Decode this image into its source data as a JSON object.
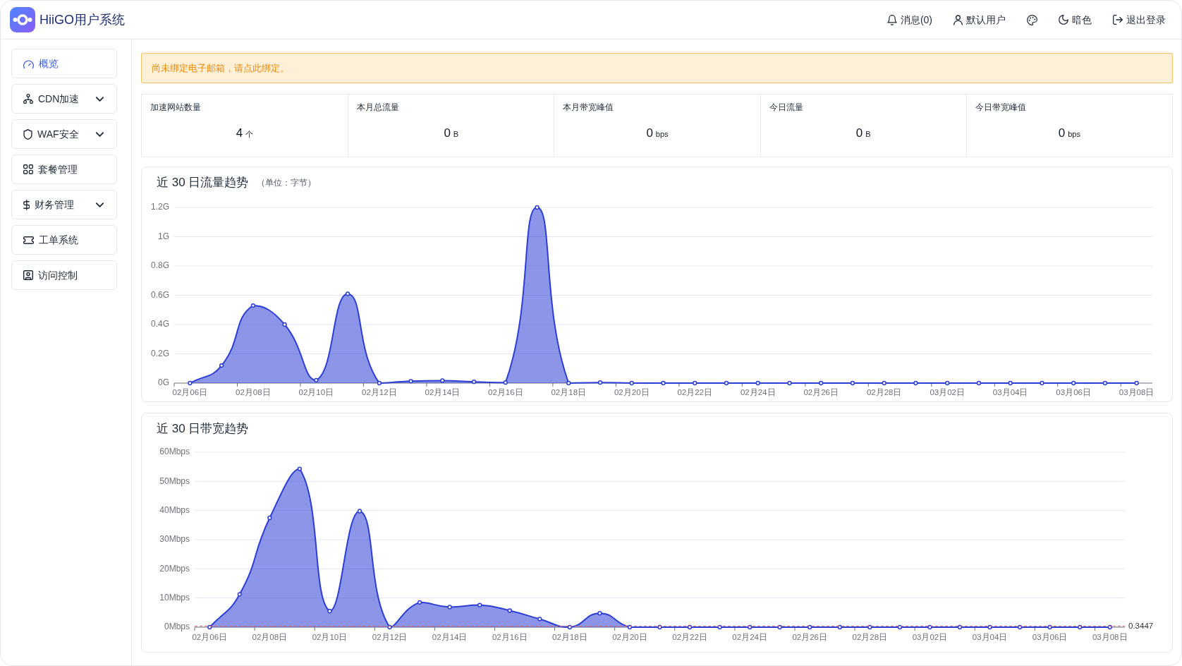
{
  "app": {
    "title": "HiiGO用户系统"
  },
  "header": {
    "actions": [
      {
        "kind": "messages",
        "label": "消息(0)"
      },
      {
        "kind": "user",
        "label": "默认用户"
      },
      {
        "kind": "theme"
      },
      {
        "kind": "dark_mode",
        "label": "暗色"
      },
      {
        "kind": "logout",
        "label": "退出登录"
      }
    ]
  },
  "sidebar": {
    "items": [
      {
        "label": "概览",
        "kind": "link",
        "selected": true
      },
      {
        "label": "CDN加速",
        "kind": "group",
        "selected": false,
        "expanded": false
      },
      {
        "label": "WAF安全",
        "kind": "group",
        "selected": false,
        "expanded": false
      },
      {
        "label": "套餐管理",
        "kind": "link",
        "selected": false
      },
      {
        "label": "财务管理",
        "kind": "group",
        "selected": false,
        "expanded": false
      },
      {
        "label": "工单系统",
        "kind": "link",
        "selected": false
      },
      {
        "label": "访问控制",
        "kind": "link",
        "selected": false
      }
    ]
  },
  "alert": {
    "text": "尚未绑定电子邮箱，请点此绑定。"
  },
  "stats": [
    {
      "label": "加速网站数量",
      "value": "4",
      "unit": "个"
    },
    {
      "label": "本月总流量",
      "value": "0",
      "unit": "B"
    },
    {
      "label": "本月带宽峰值",
      "value": "0",
      "unit": "bps"
    },
    {
      "label": "今日流量",
      "value": "0",
      "unit": "B"
    },
    {
      "label": "今日带宽峰值",
      "value": "0",
      "unit": "bps"
    }
  ],
  "charts": [
    {
      "unit_note": "（单位：字节）",
      "chart_data": {
        "type": "area",
        "title": "近 30 日流量趋势",
        "grid": true,
        "categories": [
          "02月06日",
          null,
          "02月08日",
          null,
          "02月10日",
          null,
          "02月12日",
          null,
          "02月14日",
          null,
          "02月16日",
          null,
          "02月18日",
          null,
          "02月20日",
          null,
          "02月22日",
          null,
          "02月24日",
          null,
          "02月26日",
          null,
          "02月28日",
          null,
          "03月02日",
          null,
          "03月04日",
          null,
          "03月06日",
          null,
          "03月08日"
        ],
        "series": [
          {
            "color": "#2d3ed6",
            "values": [
              0,
              0.12,
              0.53,
              0.4,
              0.02,
              0.61,
              0,
              0.013,
              0.017,
              0.009,
              0.004,
              1.2,
              0,
              0.004,
              0,
              0,
              0,
              0,
              0,
              0,
              0,
              0,
              0,
              0,
              0,
              0,
              0,
              0,
              0,
              0,
              0
            ]
          }
        ],
        "ylim": [
          0,
          1.2
        ],
        "yticks": [
          {
            "value": 0,
            "label": "0G"
          },
          {
            "value": 0.2,
            "label": "0.2G"
          },
          {
            "value": 0.4,
            "label": "0.4G"
          },
          {
            "value": 0.6,
            "label": "0.6G"
          },
          {
            "value": 0.8,
            "label": "0.8G"
          },
          {
            "value": 1,
            "label": "1G"
          },
          {
            "value": 1.2,
            "label": "1.2G"
          }
        ]
      }
    },
    {
      "chart_data": {
        "type": "area",
        "title": "近 30 日带宽趋势",
        "grid": true,
        "categories": [
          "02月06日",
          null,
          "02月08日",
          null,
          "02月10日",
          null,
          "02月12日",
          null,
          "02月14日",
          null,
          "02月16日",
          null,
          "02月18日",
          null,
          "02月20日",
          null,
          "02月22日",
          null,
          "02月24日",
          null,
          "02月26日",
          null,
          "02月28日",
          null,
          "03月02日",
          null,
          "03月04日",
          null,
          "03月06日",
          null,
          "03月08日"
        ],
        "series": [
          {
            "color": "#2d3ed6",
            "values": [
              0,
              11.3,
              37.5,
              54.3,
              5.5,
              39.8,
              0,
              8.5,
              6.9,
              7.6,
              5.7,
              2.8,
              0,
              4.8,
              0,
              0,
              0,
              0,
              0,
              0,
              0,
              0,
              0,
              0,
              0,
              0,
              0,
              0,
              0,
              0,
              0
            ]
          }
        ],
        "ylim": [
          0,
          60
        ],
        "yticks": [
          {
            "value": 0,
            "label": "0Mbps"
          },
          {
            "value": 10,
            "label": "10Mbps"
          },
          {
            "value": 20,
            "label": "20Mbps"
          },
          {
            "value": 30,
            "label": "30Mbps"
          },
          {
            "value": 40,
            "label": "40Mbps"
          },
          {
            "value": 50,
            "label": "50Mbps"
          },
          {
            "value": 60,
            "label": "60Mbps"
          }
        ],
        "ref_lines": [
          {
            "axis": "y",
            "value": 0.3447,
            "label": "0.3447",
            "color": "#e86f6f"
          }
        ]
      }
    }
  ]
}
